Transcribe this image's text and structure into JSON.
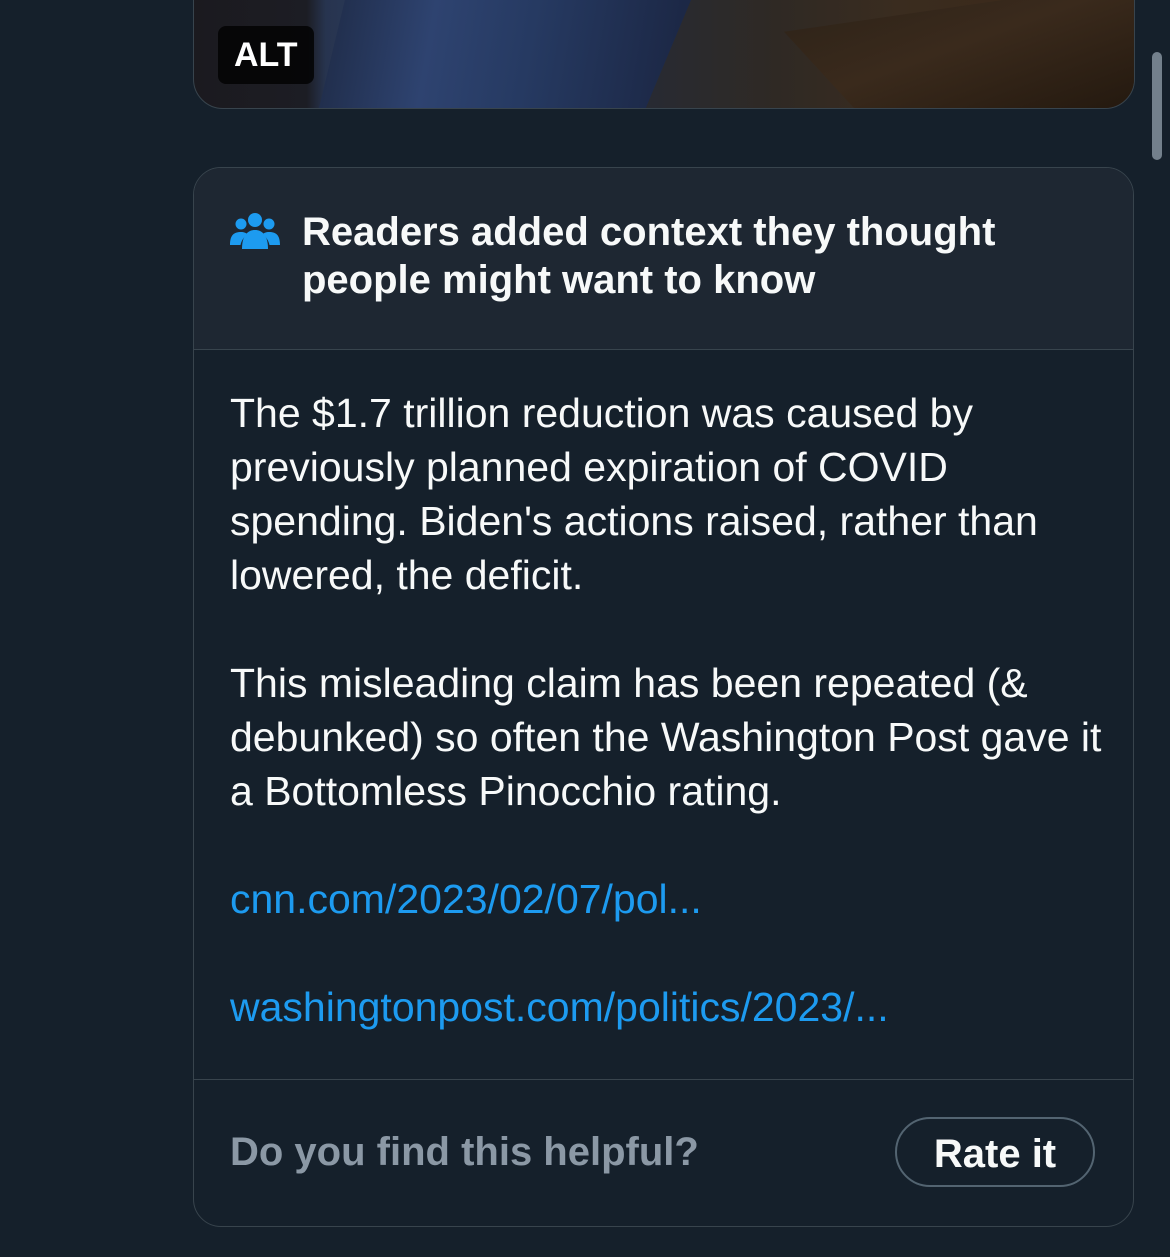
{
  "media": {
    "alt_badge": "ALT"
  },
  "note": {
    "icon": "people-group-icon",
    "title": "Readers added context they thought people might want to know",
    "paragraphs": [
      "The $1.7 trillion reduction was caused by previously planned expiration of COVID spending. Biden's actions raised, rather than lowered, the deficit.",
      "This misleading claim has been repeated (& debunked) so often the Washington Post gave it a Bottomless Pinocchio rating."
    ],
    "links": [
      "cnn.com/2023/02/07/pol...",
      "washingtonpost.com/politics/2023/..."
    ],
    "footer": {
      "question": "Do you find this helpful?",
      "rate_label": "Rate it"
    }
  },
  "colors": {
    "background": "#15202b",
    "card_header": "#1e2732",
    "border": "#38444d",
    "text_primary": "#f7f9f9",
    "text_secondary": "#8b98a5",
    "link": "#1d9bf0"
  }
}
